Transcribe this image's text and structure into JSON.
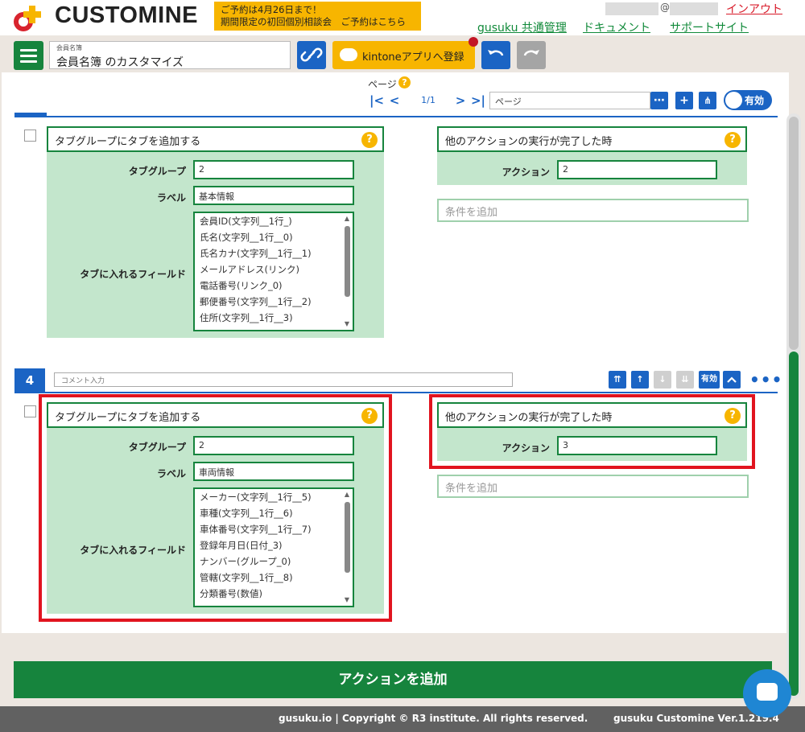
{
  "header": {
    "logo_text": "CUSTOMINE",
    "promo_line1": "ご予約は4月26日まで！",
    "promo_line2": "期間限定の初回個別相談会　ご予約はこちら",
    "at_mark": "@",
    "logout": "インアウト",
    "links": [
      "gusuku 共通管理",
      "ドキュメント",
      "サポートサイト"
    ]
  },
  "toolbar": {
    "app_name_label": "会員名簿",
    "app_name_value": "会員名簿 のカスタマイズ",
    "kintone_button": "kintoneアプリへ登録"
  },
  "pager": {
    "label": "ページ",
    "count": "1/1",
    "page_input": "ページ",
    "toggle_label": "有効"
  },
  "action_block_3": {
    "action_title": "タブグループにタブを追加する",
    "tabgroup_label": "タブグループ",
    "tabgroup_value": "2",
    "label_label": "ラベル",
    "label_value": "基本情報",
    "fields_label": "タブに入れるフィールド",
    "fields": [
      "会員ID(文字列__1行_)",
      "氏名(文字列__1行__0)",
      "氏名カナ(文字列__1行__1)",
      "メールアドレス(リンク)",
      "電話番号(リンク_0)",
      "郵便番号(文字列__1行__2)",
      "住所(文字列__1行__3)"
    ],
    "trigger_title": "他のアクションの実行が完了した時",
    "trigger_action_label": "アクション",
    "trigger_action_value": "2",
    "condition_placeholder": "条件を追加"
  },
  "row_4": {
    "number": "4",
    "comment_placeholder": "コメント入力",
    "enable_label": "有効",
    "more": "•••"
  },
  "action_block_4": {
    "action_title": "タブグループにタブを追加する",
    "tabgroup_label": "タブグループ",
    "tabgroup_value": "2",
    "label_label": "ラベル",
    "label_value": "車両情報",
    "fields_label": "タブに入れるフィールド",
    "fields": [
      "メーカー(文字列__1行__5)",
      "車種(文字列__1行__6)",
      "車体番号(文字列__1行__7)",
      "登録年月日(日付_3)",
      "ナンバー(グループ_0)",
      "管轄(文字列__1行__8)",
      "分類番号(数値)"
    ],
    "trigger_title": "他のアクションの実行が完了した時",
    "trigger_action_label": "アクション",
    "trigger_action_value": "3",
    "condition_placeholder": "条件を追加"
  },
  "add_action_button": "アクションを追加",
  "footer": {
    "copyright": "gusuku.io | Copyright © R3 institute. All rights reserved.",
    "version": "gusuku Customine Ver.1.219.4"
  },
  "colors": {
    "primary_green": "#16843d",
    "primary_blue": "#1b64c4",
    "accent_yellow": "#f7b500",
    "highlight_red": "#e1141f",
    "card_green": "#c3e6cc"
  }
}
